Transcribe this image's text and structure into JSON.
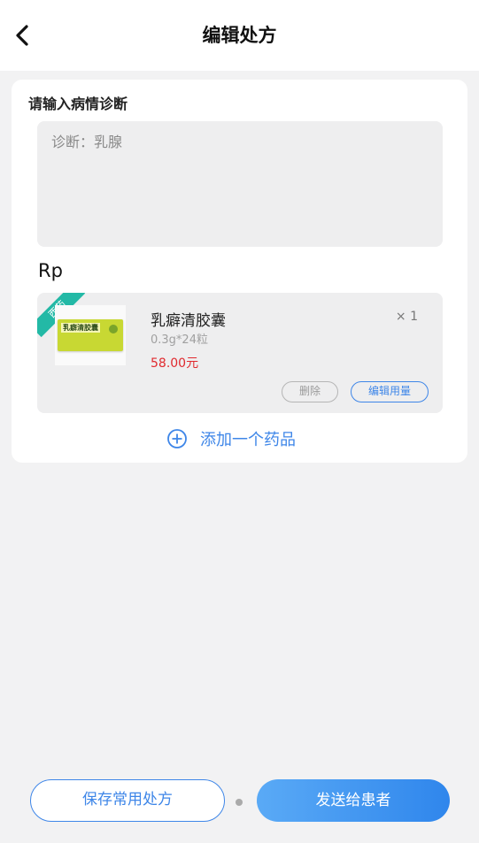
{
  "header": {
    "title": "编辑处方",
    "back_icon": "chevron-left-icon"
  },
  "diagnosis": {
    "label": "请输入病情诊断",
    "value": "诊断：乳腺"
  },
  "rp_label": "Rp",
  "drug": {
    "tag": "西药",
    "image_text": "乳癖清胶囊",
    "name": "乳癖清胶囊",
    "spec": "0.3g*24粒",
    "price": "58.00元",
    "quantity": "× 1",
    "delete_label": "删除",
    "edit_dose_label": "编辑用量"
  },
  "add_drug": {
    "icon": "plus-circle-icon",
    "label": "添加一个药品"
  },
  "footer": {
    "save_label": "保存常用处方",
    "send_label": "发送给患者"
  },
  "colors": {
    "accent": "#3e86e8",
    "price": "#e0292e",
    "tag": "#23b9a6",
    "background": "#f2f2f3"
  }
}
